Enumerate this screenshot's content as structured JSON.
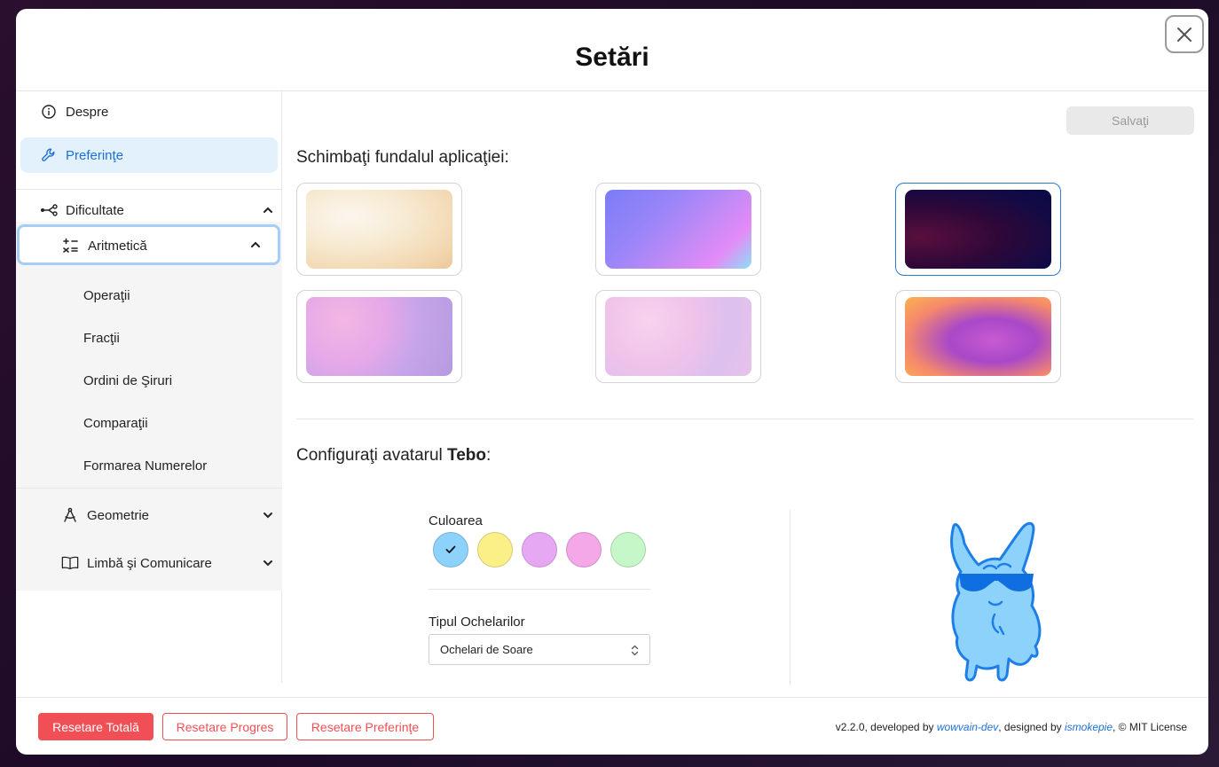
{
  "modal": {
    "title": "Setări",
    "close_icon": "close-icon"
  },
  "sidebar": {
    "despre": "Despre",
    "preferinte": "Preferinţe",
    "dificultate": "Dificultate",
    "aritmetica": "Aritmetică",
    "aritmetica_items": [
      "Operaţii",
      "Fracţii",
      "Ordini de Şiruri",
      "Comparaţii",
      "Formarea Numerelor"
    ],
    "geometrie": "Geometrie",
    "limba": "Limbă şi Comunicare"
  },
  "content": {
    "save_label": "Salvaţi",
    "background_label": "Schimbaţi fundalul aplicaţiei:",
    "avatar_label_prefix": "Configuraţi avatarul ",
    "avatar_name": "Tebo",
    "avatar_label_suffix": ":",
    "color_label": "Culoarea",
    "colors": [
      "#8dd2fb",
      "#fbef87",
      "#e6a8f2",
      "#f4a8e8",
      "#c6f7c9"
    ],
    "selected_color_index": 0,
    "glasses_label": "Tipul Ochelarilor",
    "glasses_value": "Ochelari de Soare",
    "selected_background_index": 2
  },
  "footer": {
    "reset_total": "Resetare Totală",
    "reset_progress": "Resetare Progres",
    "reset_preferences": "Resetare Preferinţe",
    "credits_prefix": "v2.2.0, developed by ",
    "developer": "wowvain-dev",
    "credits_mid": ", designed by ",
    "designer": "ismokepie",
    "credits_suffix": ", © MIT License"
  }
}
